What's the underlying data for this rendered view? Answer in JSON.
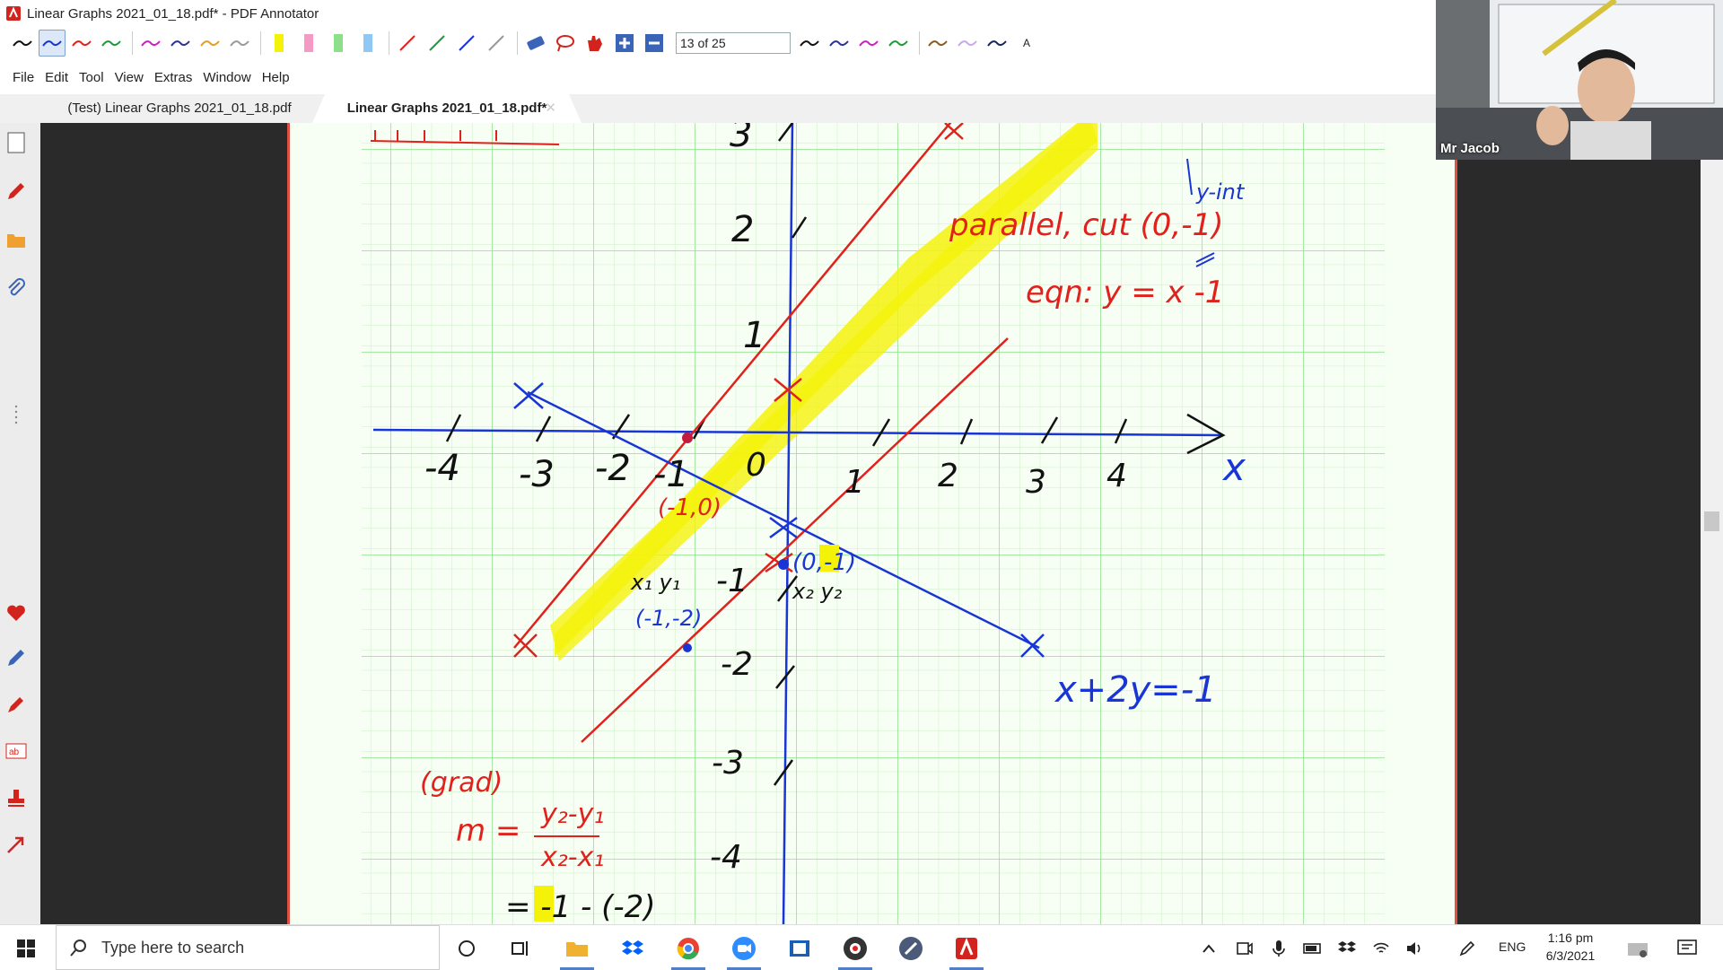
{
  "window": {
    "title": "Linear Graphs 2021_01_18.pdf* - PDF Annotator"
  },
  "toolbar": {
    "page_field": "13 of 25",
    "last_label": "A"
  },
  "menu": {
    "items": [
      "File",
      "Edit",
      "Tool",
      "View",
      "Extras",
      "Window",
      "Help"
    ]
  },
  "tabs": [
    {
      "label": "(Test) Linear Graphs 2021_01_18.pdf"
    },
    {
      "label": "Linear Graphs 2021_01_18.pdf*"
    }
  ],
  "webcam": {
    "name": "Mr Jacob"
  },
  "taskbar": {
    "search_placeholder": "Type here to search",
    "lang": "ENG",
    "time": "1:16 pm",
    "date": "6/3/2021"
  },
  "colors": {
    "accent_red": "#e0211c",
    "pen_blue": "#1a35d6",
    "highlight": "#f5f20a",
    "grid_green": "#8ce08a"
  },
  "annotations": {
    "x_ticks": [
      "-4",
      "-3",
      "-2",
      "-1",
      "0",
      "1",
      "2",
      "3",
      "4"
    ],
    "y_ticks": [
      "3",
      "2",
      "1",
      "-1",
      "-2",
      "-3",
      "-4"
    ],
    "x_axis_label": "x",
    "point_a": "(-1,0)",
    "point_b": "(0,-1)",
    "point_c": "(-1,-2)",
    "x1y1": "x₁ y₁",
    "x2y2": "x₂ y₂",
    "parallel_note": "parallel, cut (0,-1)",
    "eqn_note": "eqn:  y = x -1",
    "yint_note": "y-int",
    "line_eq": "x+2y=-1",
    "grad_label": "(grad)",
    "m_eq": "m =",
    "formula_num": "y₂-y₁",
    "formula_den": "x₂-x₁",
    "sub_line": "= -1 - (-2)"
  }
}
